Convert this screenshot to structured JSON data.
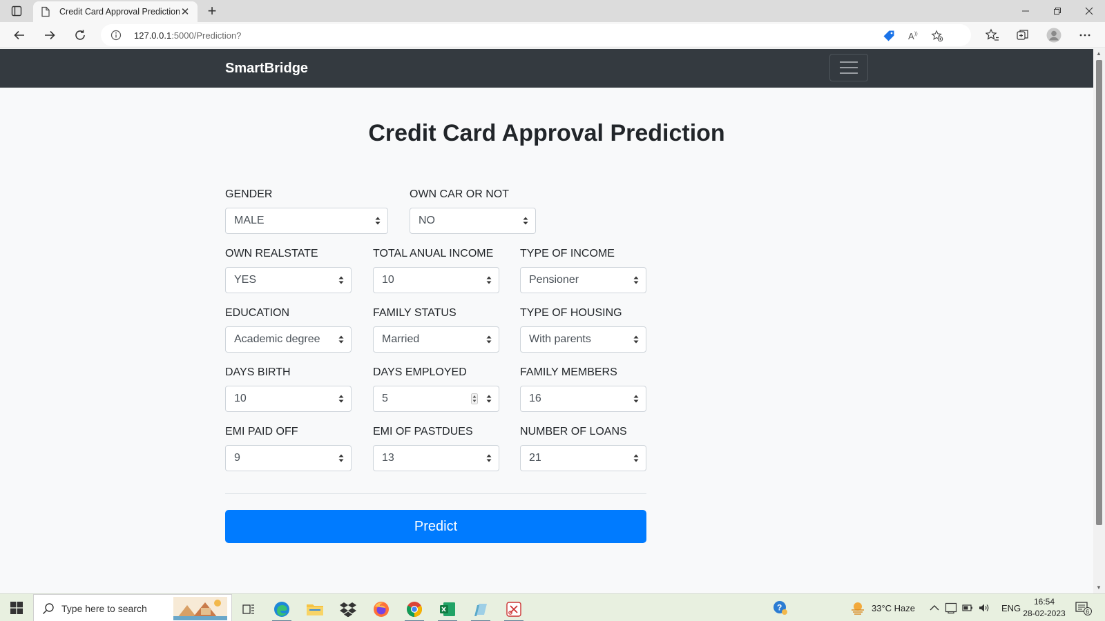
{
  "browser": {
    "tab_title": "Credit Card Approval Prediction",
    "url_host": "127.0.0.1",
    "url_path": ":5000/Prediction?"
  },
  "page": {
    "brand": "SmartBridge",
    "title": "Credit Card Approval Prediction",
    "fields": [
      {
        "label": "GENDER",
        "value": "MALE"
      },
      {
        "label": "OWN CAR OR NOT",
        "value": "NO"
      },
      {
        "label": "OWN REALSTATE",
        "value": "YES"
      },
      {
        "label": "TOTAL ANUAL INCOME",
        "value": "10"
      },
      {
        "label": "TYPE OF INCOME",
        "value": "Pensioner"
      },
      {
        "label": "EDUCATION",
        "value": "Academic degree"
      },
      {
        "label": "FAMILY STATUS",
        "value": "Married"
      },
      {
        "label": "TYPE OF HOUSING",
        "value": "With parents"
      },
      {
        "label": "DAYS BIRTH",
        "value": "10"
      },
      {
        "label": "DAYS EMPLOYED",
        "value": "5"
      },
      {
        "label": "FAMILY MEMBERS",
        "value": "16"
      },
      {
        "label": "EMI PAID OFF",
        "value": "9"
      },
      {
        "label": "EMI OF PASTDUES",
        "value": "13"
      },
      {
        "label": "NUMBER OF LOANS",
        "value": "21"
      }
    ],
    "predict_label": "Predict"
  },
  "taskbar": {
    "search_placeholder": "Type here to search",
    "weather": "33°C  Haze",
    "language": "ENG",
    "time": "16:54",
    "date": "28-02-2023",
    "notification_count": "6"
  },
  "colors": {
    "navbar": "#343a40",
    "primary": "#007bff",
    "page_bg": "#f8f9fa"
  }
}
